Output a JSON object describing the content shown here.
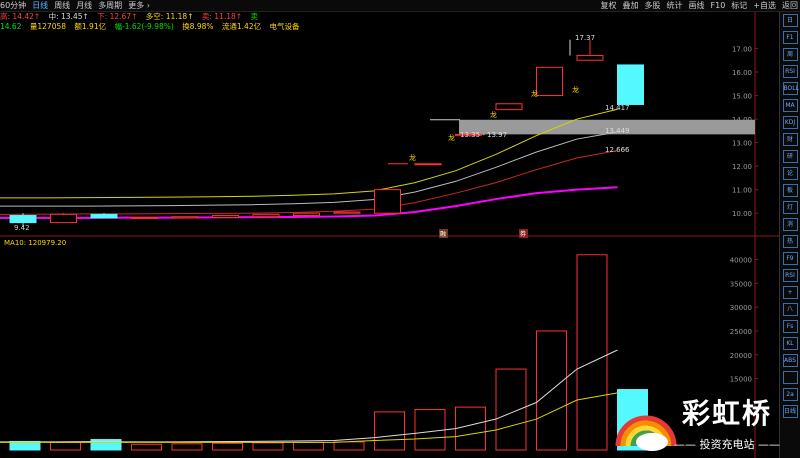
{
  "toolbar": {
    "left": [
      "60分钟",
      "日线",
      "周线",
      "月线",
      "多周期",
      "更多"
    ],
    "active_index": 1,
    "right": [
      "复权",
      "叠加",
      "多股",
      "统计",
      "画线",
      "F10",
      "标记",
      "+自选",
      "返回"
    ]
  },
  "info": {
    "high": "14.42",
    "mid": "13.45",
    "low": "12.67",
    "dk_label": "多空:",
    "dk": "11.18",
    "sell_label": "卖",
    "sell": "11.18",
    "buy_label": "卖",
    "row2_open": "14.62",
    "row2_vol": "量127058",
    "row2_amt": "额1.91亿",
    "row2_chg": "幅-1.62(-9.98%)",
    "row2_turn": "换8.98%",
    "row2_float": "流通1.42亿",
    "row2_industry": "电气设备"
  },
  "price_axis": [
    "17.00",
    "16.00",
    "15.00",
    "14.00",
    "13.00",
    "12.00",
    "11.00",
    "10.00"
  ],
  "vol_axis": [
    "40000",
    "35000",
    "30000",
    "25000",
    "20000",
    "15000"
  ],
  "annotations": {
    "peak": "17.37",
    "ma_yellow": "14.417",
    "ma_white": "13.449",
    "ma_red": "12.666",
    "range": "13.35 - 13.97",
    "dragon": "龙",
    "low_label": "9.42",
    "vol_ma": "MA10: 120979.20",
    "flag1": "融",
    "flag2": "券"
  },
  "logo": {
    "title": "彩虹桥",
    "sub": "投资充电站"
  },
  "sidebar": [
    "日",
    "F1",
    "周",
    "RSI",
    "BOLL",
    "MA",
    "KDJ",
    "财",
    "研",
    "论",
    "板",
    "灯",
    "消",
    "热",
    "F9",
    "RSI",
    "+",
    "八",
    "Fs",
    "KL",
    "ABS",
    "",
    "2a",
    "日线"
  ],
  "candles": [
    {
      "o": 9.9,
      "c": 9.6,
      "h": 10.0,
      "l": 9.42
    },
    {
      "o": 9.6,
      "c": 9.95,
      "h": 10.0,
      "l": 9.6
    },
    {
      "o": 9.95,
      "c": 9.8,
      "h": 10.0,
      "l": 9.8
    },
    {
      "o": 9.8,
      "c": 9.82,
      "h": 9.82,
      "l": 9.78
    },
    {
      "o": 9.8,
      "c": 9.85,
      "h": 9.85,
      "l": 9.8
    },
    {
      "o": 9.82,
      "c": 9.9,
      "h": 9.9,
      "l": 9.82
    },
    {
      "o": 9.85,
      "c": 9.95,
      "h": 9.95,
      "l": 9.85
    },
    {
      "o": 9.9,
      "c": 10.0,
      "h": 10.0,
      "l": 9.9
    },
    {
      "o": 10.0,
      "c": 10.05,
      "h": 10.05,
      "l": 10.0
    },
    {
      "o": 10.0,
      "c": 11.0,
      "h": 11.0,
      "l": 10.0
    },
    {
      "o": 12.1,
      "c": 12.1,
      "h": 12.1,
      "l": 12.1
    },
    {
      "o": 13.35,
      "c": 13.35,
      "h": 13.35,
      "l": 13.35
    },
    {
      "o": 14.4,
      "c": 14.65,
      "h": 14.65,
      "l": 14.4
    },
    {
      "o": 15.0,
      "c": 16.2,
      "h": 16.2,
      "l": 15.0
    },
    {
      "o": 16.5,
      "c": 16.7,
      "h": 17.37,
      "l": 16.5
    },
    {
      "o": 16.3,
      "c": 14.62,
      "h": 16.3,
      "l": 14.62
    }
  ],
  "volumes": [
    1800,
    1600,
    2200,
    1200,
    1300,
    1400,
    1500,
    1600,
    1700,
    8000,
    8500,
    9000,
    17000,
    25000,
    41000,
    12700
  ],
  "ma_yellow": [
    10.65,
    10.65,
    10.66,
    10.67,
    10.68,
    10.7,
    10.72,
    10.76,
    10.82,
    10.95,
    11.3,
    11.8,
    12.5,
    13.3,
    14.0,
    14.417
  ],
  "ma_white": [
    10.3,
    10.3,
    10.3,
    10.31,
    10.32,
    10.34,
    10.36,
    10.4,
    10.46,
    10.58,
    10.9,
    11.35,
    11.95,
    12.6,
    13.15,
    13.449
  ],
  "ma_red": [
    9.95,
    9.96,
    9.97,
    9.97,
    9.98,
    9.99,
    10.0,
    10.03,
    10.08,
    10.17,
    10.45,
    10.85,
    11.3,
    11.85,
    12.35,
    12.666
  ],
  "ma_magenta": [
    9.8,
    9.8,
    9.8,
    9.81,
    9.81,
    9.82,
    9.83,
    9.84,
    9.86,
    9.9,
    10.05,
    10.3,
    10.6,
    10.85,
    11.0,
    11.1
  ],
  "vol_ma": [
    1700,
    1700,
    1750,
    1700,
    1700,
    1750,
    1800,
    1900,
    2000,
    2600,
    3500,
    4500,
    6500,
    10000,
    17000,
    21000
  ],
  "vol_ma2": [
    1600,
    1600,
    1600,
    1600,
    1600,
    1600,
    1600,
    1600,
    1600,
    2000,
    2300,
    2800,
    4200,
    6500,
    10500,
    12000
  ]
}
